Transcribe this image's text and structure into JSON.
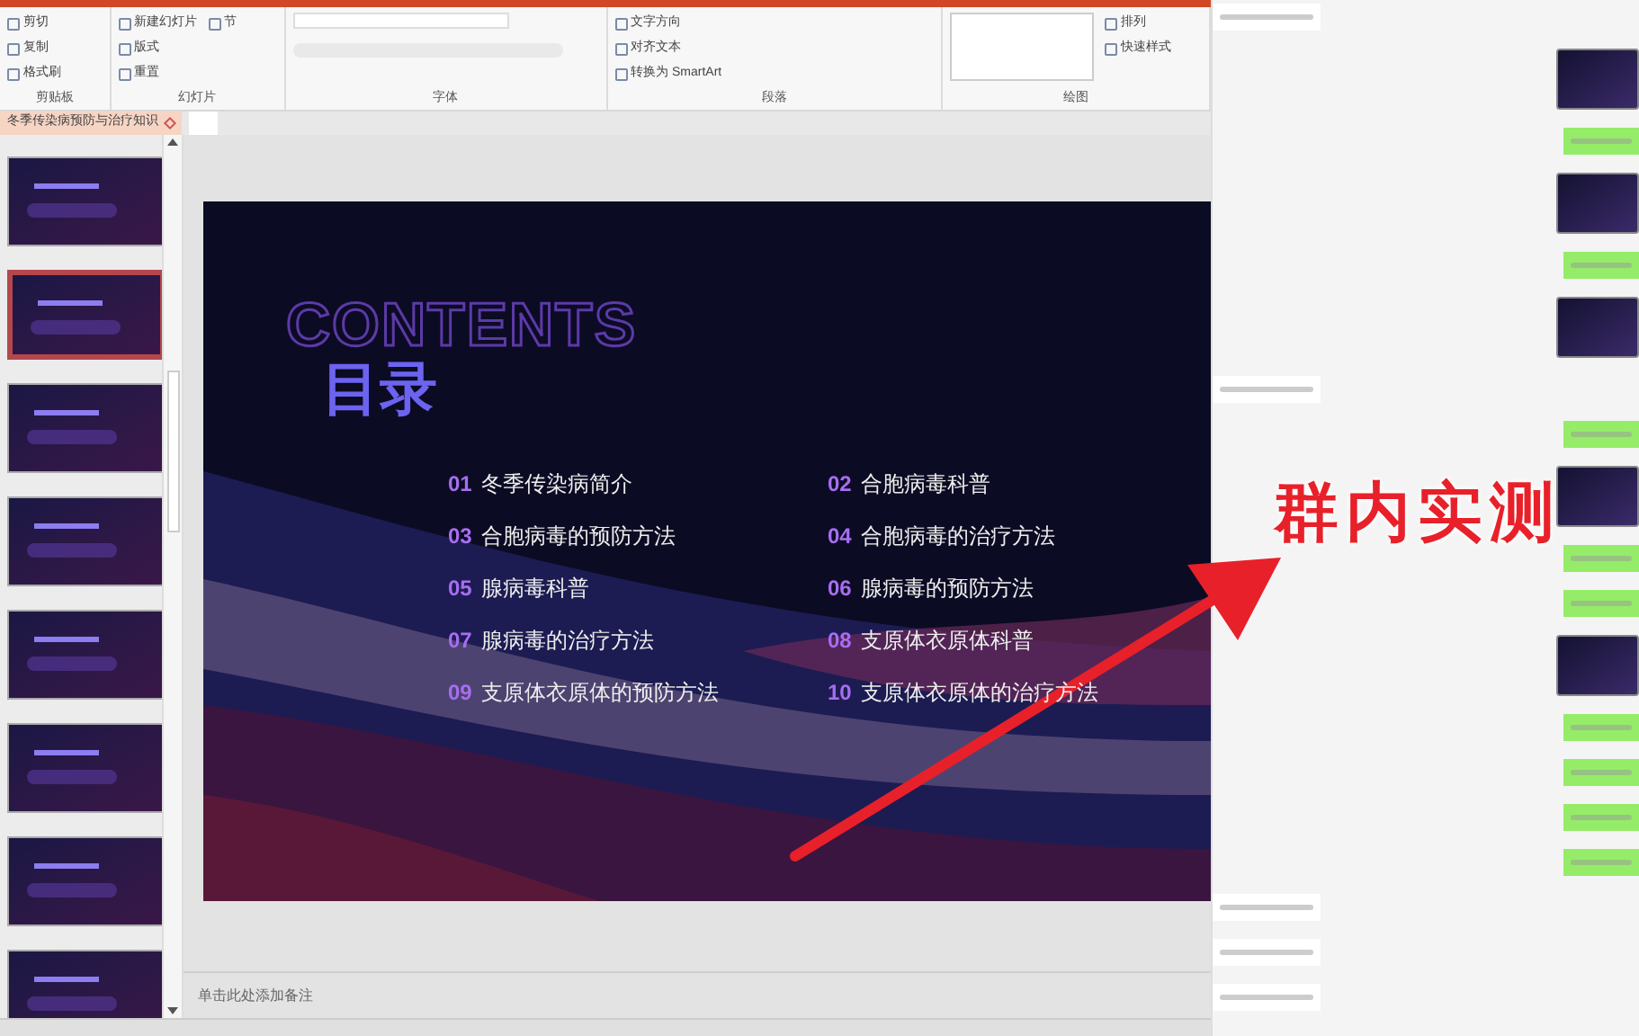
{
  "ribbon": {
    "groups": [
      {
        "label": "剪贴板",
        "items": [
          "剪切",
          "复制",
          "格式刷"
        ]
      },
      {
        "label": "幻灯片",
        "items": [
          "新建幻灯片",
          "版式",
          "重置",
          "节"
        ]
      },
      {
        "label": "字体"
      },
      {
        "label": "段落",
        "items": [
          "文字方向",
          "对齐文本",
          "转换为 SmartArt"
        ]
      },
      {
        "label": "绘图",
        "items": [
          "排列",
          "快速样式"
        ]
      }
    ]
  },
  "document_tab": {
    "title": "冬季传染病预防与治疗知识",
    "selected": true
  },
  "thumbnails": [
    {
      "selected": false
    },
    {
      "selected": true
    },
    {
      "selected": false
    },
    {
      "selected": false
    },
    {
      "selected": false
    },
    {
      "selected": false
    },
    {
      "selected": false
    },
    {
      "selected": false
    }
  ],
  "slide": {
    "heading_outline": "CONTENTS",
    "heading": "目录",
    "items": [
      {
        "number": "01",
        "text": "冬季传染病简介"
      },
      {
        "number": "02",
        "text": "合胞病毒科普"
      },
      {
        "number": "03",
        "text": "合胞病毒的预防方法"
      },
      {
        "number": "04",
        "text": "合胞病毒的治疗方法"
      },
      {
        "number": "05",
        "text": "腺病毒科普"
      },
      {
        "number": "06",
        "text": "腺病毒的预防方法"
      },
      {
        "number": "07",
        "text": "腺病毒的治疗方法"
      },
      {
        "number": "08",
        "text": "支原体衣原体科普"
      },
      {
        "number": "09",
        "text": "支原体衣原体的预防方法"
      },
      {
        "number": "10",
        "text": "支原体衣原体的治疗方法"
      }
    ]
  },
  "notes": {
    "placeholder": "单击此处添加备注"
  },
  "chat": {
    "messages": [
      {
        "outgoing": false,
        "kind": "text"
      },
      {
        "outgoing": true,
        "kind": "image"
      },
      {
        "outgoing": true,
        "kind": "text"
      },
      {
        "outgoing": true,
        "kind": "image"
      },
      {
        "outgoing": true,
        "kind": "text"
      },
      {
        "outgoing": true,
        "kind": "image"
      },
      {
        "outgoing": false,
        "kind": "text"
      },
      {
        "outgoing": true,
        "kind": "text"
      },
      {
        "outgoing": true,
        "kind": "image"
      },
      {
        "outgoing": true,
        "kind": "text"
      },
      {
        "outgoing": true,
        "kind": "text"
      },
      {
        "outgoing": true,
        "kind": "image"
      },
      {
        "outgoing": true,
        "kind": "text"
      },
      {
        "outgoing": true,
        "kind": "text"
      },
      {
        "outgoing": true,
        "kind": "text"
      },
      {
        "outgoing": true,
        "kind": "text"
      },
      {
        "outgoing": false,
        "kind": "text"
      },
      {
        "outgoing": false,
        "kind": "text"
      },
      {
        "outgoing": false,
        "kind": "text"
      }
    ]
  },
  "annotation": {
    "text": "群内实测"
  }
}
